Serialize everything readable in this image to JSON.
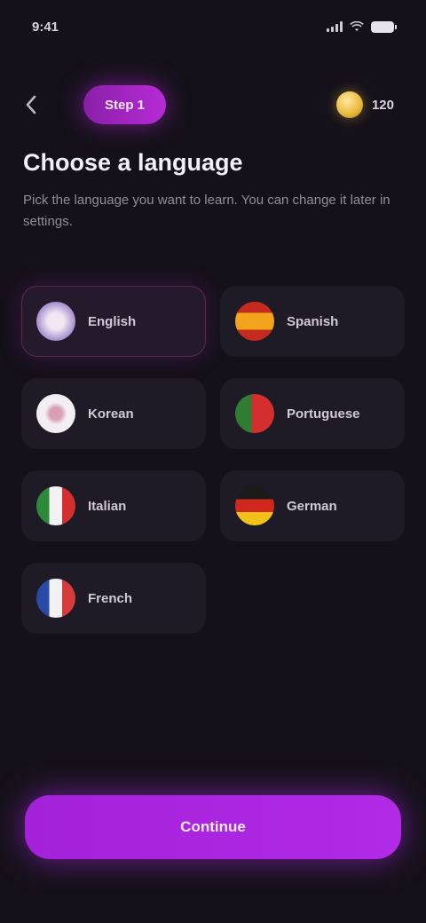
{
  "status_bar": {
    "time": "9:41"
  },
  "header": {
    "back_icon": "chevron-left-icon",
    "step_label": "Step 1",
    "coins": "120"
  },
  "title": "Choose a language",
  "subtitle": "Pick the language you want to learn. You can change it later in settings.",
  "languages": [
    {
      "label": "English",
      "flag": "flag-gb",
      "selected": true
    },
    {
      "label": "Spanish",
      "flag": "flag-es",
      "selected": false
    },
    {
      "label": "Korean",
      "flag": "flag-kr",
      "selected": false
    },
    {
      "label": "Portuguese",
      "flag": "flag-pt",
      "selected": false
    },
    {
      "label": "Italian",
      "flag": "flag-it",
      "selected": false
    },
    {
      "label": "German",
      "flag": "flag-de",
      "selected": false
    },
    {
      "label": "French",
      "flag": "flag-fr",
      "selected": false
    }
  ],
  "continue_label": "Continue",
  "colors": {
    "background": "#15111a",
    "accent": "#b12ae6",
    "chip": "#1f1b26"
  }
}
